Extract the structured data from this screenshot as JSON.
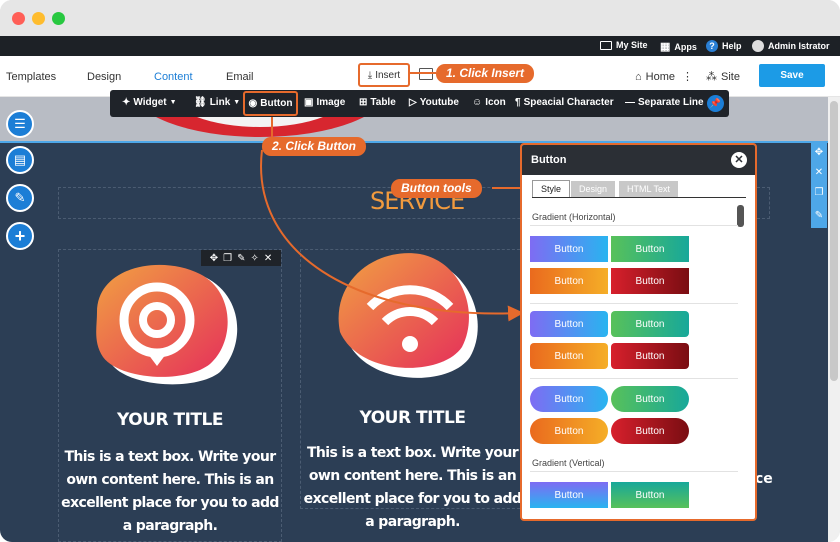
{
  "topbar": {
    "mysite": "My Site",
    "apps": "Apps",
    "help": "Help",
    "user": "Admin Istrator"
  },
  "nav": {
    "templates": "Templates",
    "design": "Design",
    "content": "Content",
    "email": "Email",
    "insert": "Insert",
    "home": "Home",
    "site": "Site",
    "save": "Save"
  },
  "toolbar": {
    "widget": "Widget",
    "link": "Link",
    "button": "Button",
    "image": "Image",
    "table": "Table",
    "youtube": "Youtube",
    "icon": "Icon",
    "special": "Speacial Character",
    "separate": "Separate Line"
  },
  "callouts": {
    "c1": "1. Click Insert",
    "c2": "2. Click Button",
    "c3": "Button tools"
  },
  "page": {
    "service": "SERVICE",
    "card1_title": "YOUR TITLE",
    "card1_text": "This is a text box. Write your own content here. This is an excellent place for you to add a paragraph.",
    "card2_title": "YOUR TITLE",
    "card2_text": "This is a text box. Write your own content here. This is an excellent place for you to add a paragraph.",
    "ce": "ce"
  },
  "panel": {
    "title": "Button",
    "tabs": [
      "Style",
      "Design",
      "HTML Text"
    ],
    "section1": "Gradient (Horizontal)",
    "section2": "Gradient (Vertical)",
    "button_label": "Button"
  },
  "colors": {
    "accent": "#e66a2c",
    "save": "#1c9be6",
    "service": "#f19a3e"
  }
}
